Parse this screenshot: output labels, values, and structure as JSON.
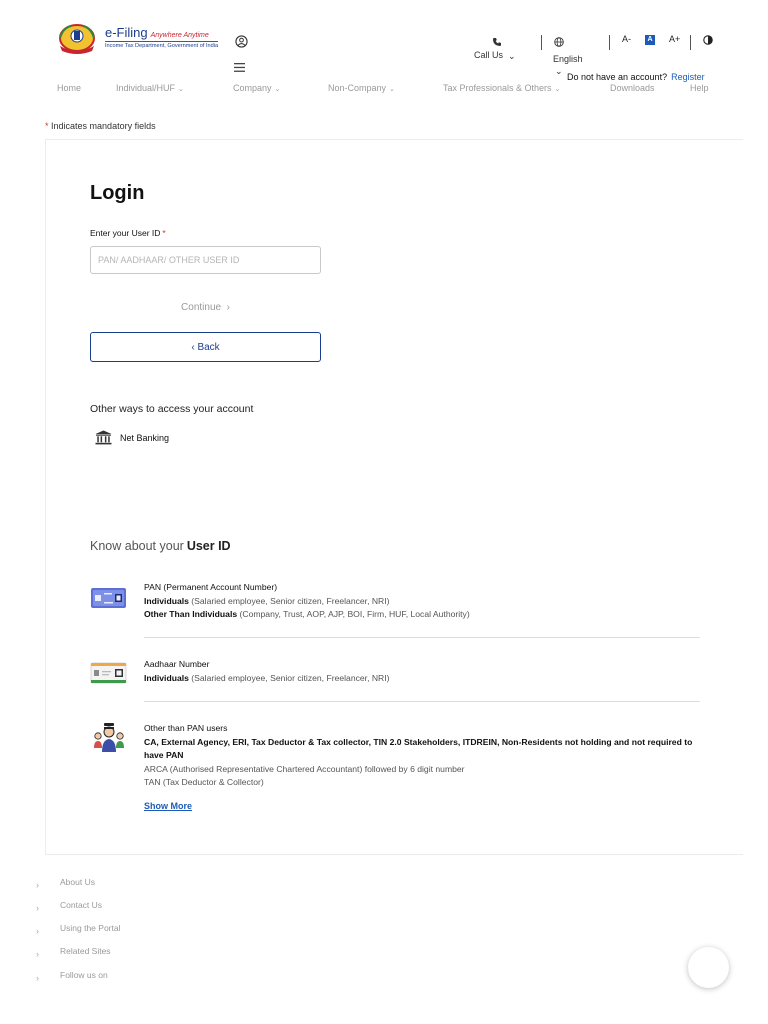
{
  "header": {
    "logo": {
      "title": "e-Filing",
      "tagline": "Anywhere Anytime",
      "subtitle": "Income Tax Department, Government of India"
    },
    "call_us": "Call Us",
    "language": "English",
    "font_controls": {
      "decrease": "A-",
      "default": "A",
      "increase": "A+"
    },
    "account_prompt": "Do not have an account?",
    "register_label": "Register"
  },
  "nav": {
    "items": [
      {
        "label": "Home",
        "has_dropdown": false
      },
      {
        "label": "Individual/HUF",
        "has_dropdown": true
      },
      {
        "label": "Company",
        "has_dropdown": true
      },
      {
        "label": "Non-Company",
        "has_dropdown": true
      },
      {
        "label": "Tax Professionals & Others",
        "has_dropdown": true
      },
      {
        "label": "Downloads",
        "has_dropdown": false
      },
      {
        "label": "Help",
        "has_dropdown": false
      }
    ]
  },
  "mandatory_note": "Indicates mandatory fields",
  "login": {
    "title": "Login",
    "user_id_label": "Enter your User ID",
    "user_id_value": "",
    "user_id_placeholder": "PAN/ AADHAAR/ OTHER USER ID",
    "continue_label": "Continue",
    "back_label": "Back",
    "other_ways_heading": "Other ways to access your account",
    "net_banking_label": "Net Banking"
  },
  "know_about": {
    "prefix": "Know about your",
    "emphasis": "User ID",
    "items": [
      {
        "icon": "pan-card-icon",
        "title": "PAN (Permanent Account Number)",
        "line2_bold": "Individuals",
        "line2_rest": "(Salaried employee, Senior citizen, Freelancer, NRI)",
        "line3_bold": "Other Than Individuals",
        "line3_rest": "(Company, Trust, AOP, AJP, BOI, Firm, HUF, Local Authority)"
      },
      {
        "icon": "aadhaar-card-icon",
        "title": "Aadhaar Number",
        "line2_bold": "Individuals",
        "line2_rest": "(Salaried employee, Senior citizen, Freelancer, NRI)"
      },
      {
        "icon": "other-users-icon",
        "title": "Other than PAN users",
        "bold_text": "CA, External Agency, ERI, Tax Deductor & Tax collector, TIN 2.0 Stakeholders, ITDREIN, Non-Residents not holding and not required to have PAN",
        "line_arca": "ARCA (Authorised Representative Chartered Accountant) followed by 6 digit number",
        "line_tan": "TAN (Tax Deductor & Collector)"
      }
    ],
    "show_more": "Show More"
  },
  "footer": {
    "links": [
      "About Us",
      "Contact Us",
      "Using the Portal",
      "Related Sites",
      "Follow us on"
    ]
  },
  "colors": {
    "brand_blue": "#1c3d8f",
    "link_blue": "#1e5bb8",
    "required_red": "#d0342c"
  }
}
